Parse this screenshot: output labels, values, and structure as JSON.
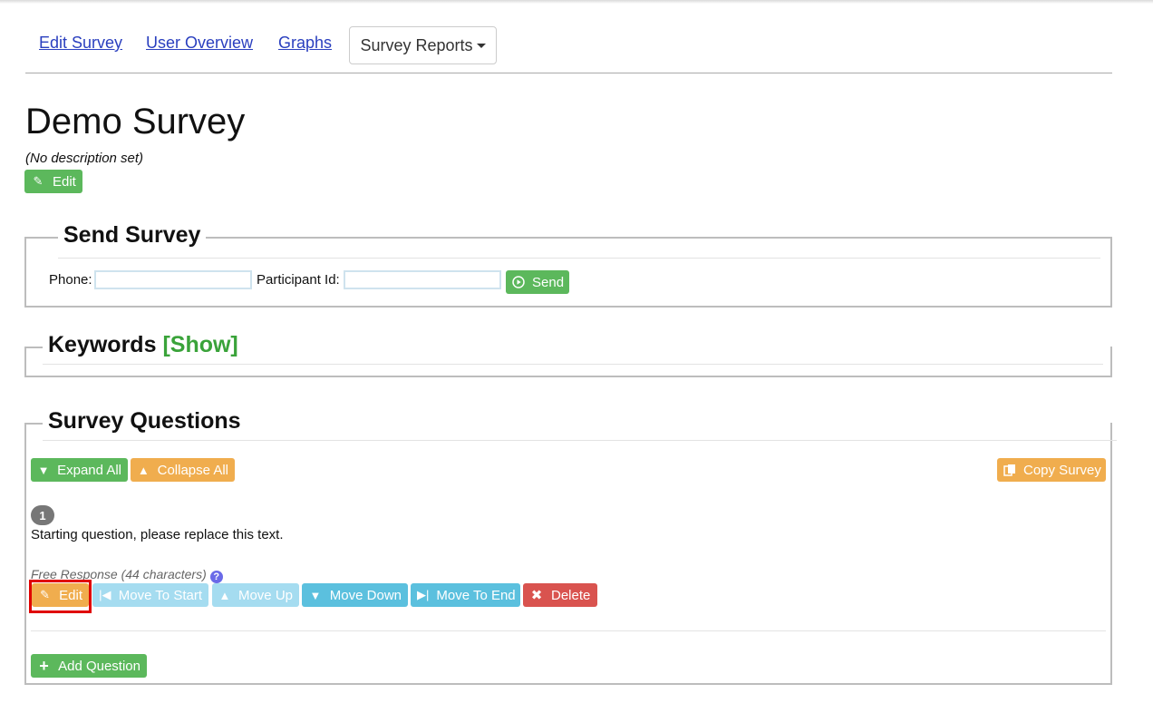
{
  "nav": {
    "edit_survey": "Edit Survey",
    "user_overview": "User Overview",
    "graphs": "Graphs",
    "survey_reports": "Survey Reports"
  },
  "survey": {
    "title": "Demo Survey",
    "description": "(No description set)",
    "edit_label": "Edit"
  },
  "send_survey": {
    "heading": "Send Survey",
    "phone_label": "Phone:",
    "phone_value": "",
    "participant_label": "Participant Id:",
    "participant_value": "",
    "send_label": "Send"
  },
  "keywords": {
    "heading": "Keywords",
    "show_label": "[Show]"
  },
  "questions": {
    "heading": "Survey Questions",
    "expand_all": "Expand All",
    "collapse_all": "Collapse All",
    "copy_survey": "Copy Survey",
    "items": [
      {
        "number": "1",
        "text": "Starting question, please replace this text.",
        "type": "Free Response (44 characters)",
        "actions": {
          "edit": "Edit",
          "move_to_start": "Move To Start",
          "move_up": "Move Up",
          "move_down": "Move Down",
          "move_to_end": "Move To End",
          "delete": "Delete"
        }
      }
    ],
    "add_question": "Add Question"
  },
  "icons": {
    "help": "?"
  },
  "colors": {
    "success": "#5cb85c",
    "warning": "#f0ad4e",
    "info": "#5bc0de",
    "danger": "#d9534f",
    "link": "#2a3fbf",
    "highlight": "#e00000"
  }
}
